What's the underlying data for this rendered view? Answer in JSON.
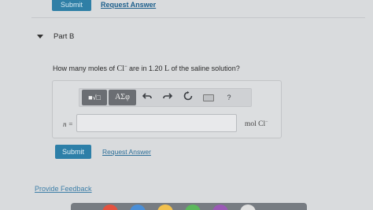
{
  "previous_part": {
    "submit_label": "Submit",
    "request_answer_label": "Request Answer"
  },
  "part": {
    "title": "Part B"
  },
  "question": {
    "text_before": "How many moles of ",
    "ion": "Cl",
    "ion_charge": "−",
    "text_middle": " are in 1.20 ",
    "unit_volume": "L",
    "text_after": " of the saline solution?"
  },
  "toolbar": {
    "template_label": "■√□",
    "greek_label": "AΣφ",
    "help_label": "?"
  },
  "answer": {
    "variable_label": "n =",
    "value": "",
    "unit": "mol Cl",
    "unit_charge": "−"
  },
  "actions": {
    "submit_label": "Submit",
    "request_answer_label": "Request Answer"
  },
  "footer": {
    "feedback_label": "Provide Feedback"
  },
  "colors": {
    "accent": "#2d7fa8",
    "link": "#2d6f98",
    "background": "#d9dbdd"
  }
}
